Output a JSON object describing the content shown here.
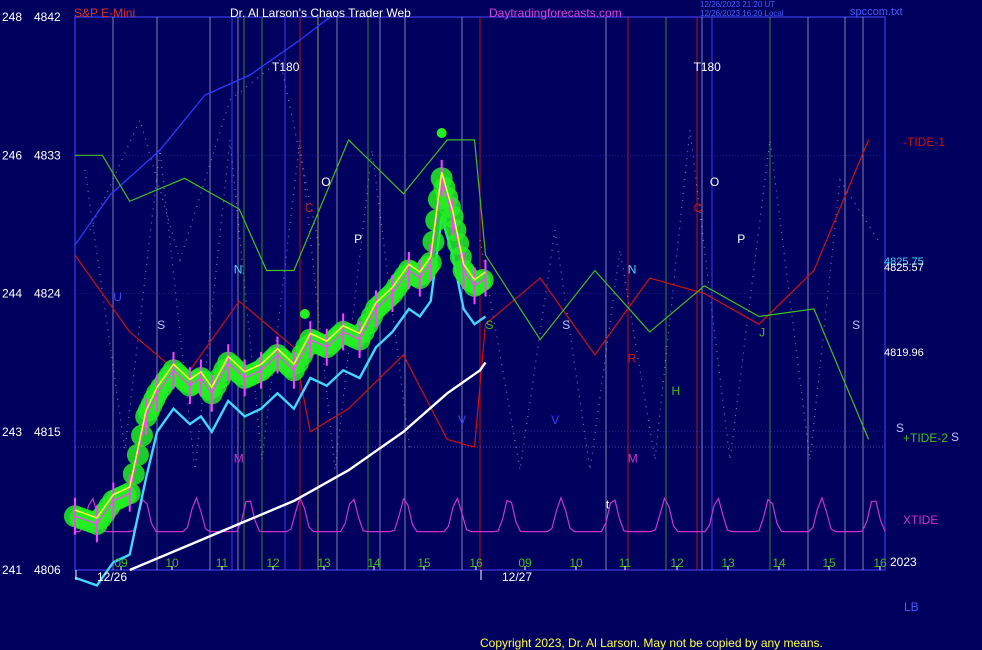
{
  "header": {
    "instrument": "S&P E-Mini",
    "site_title": "Dr. Al Larson's Chaos Trader Web",
    "site_url": "Daytradingforecasts.com",
    "timestamp_line1": "12/26/2023 21:20 UT",
    "timestamp_line2": "12/26/2023 16:20 Local",
    "file_name": "spccom.txt"
  },
  "footer": {
    "copyright": "Copyright 2023, Dr. Al Larson. May not be copied by any means."
  },
  "corner_label": "LB",
  "year_label": "2023",
  "colors": {
    "background": "#00005e",
    "frame": "#3030d0",
    "price_bars": "#ff44ff",
    "moving_average": "#ffff40",
    "glow": "#22ee22",
    "cyan_line": "#40d8ff",
    "white_line": "#ffffff",
    "blue_line": "#2a3cff",
    "tide1": "#d01010",
    "tide2": "#40c020",
    "xtide": "#cc33cc"
  },
  "chart_data": {
    "type": "line",
    "title": "S&P E-Mini",
    "x_unit": "hour of day (Dec 26 continuing into Dec 27)",
    "ylim": [
      4806,
      4842
    ],
    "y_ticks": [
      {
        "angle": "241",
        "price": "4806",
        "value": 4806
      },
      {
        "angle": "243",
        "price": "4815",
        "value": 4815
      },
      {
        "angle": "244",
        "price": "4824",
        "value": 4824
      },
      {
        "angle": "246",
        "price": "4833",
        "value": 4833
      },
      {
        "angle": "248",
        "price": "4842",
        "value": 4842
      }
    ],
    "x_ticks": [
      "09",
      "10",
      "11",
      "12",
      "13",
      "14",
      "15",
      "16",
      "09",
      "10",
      "11",
      "12",
      "13",
      "14",
      "15",
      "16"
    ],
    "date_labels": [
      "12/26",
      "12/27"
    ],
    "right_price_labels": [
      "4825.75",
      "4825.57",
      "4819.96"
    ],
    "series": [
      {
        "name": "S&P E-Mini",
        "x": [
          8.5,
          8.9,
          9.2,
          9.5,
          9.8,
          10.0,
          10.3,
          10.6,
          10.8,
          11.0,
          11.3,
          11.6,
          11.9,
          12.2,
          12.5,
          12.8,
          13.1,
          13.4,
          13.7,
          14.0,
          14.3,
          14.6,
          14.8,
          15.0,
          15.2,
          15.4,
          15.6,
          15.8,
          16.0
        ],
        "values": [
          4809.5,
          4809.0,
          4810.5,
          4811.0,
          4816.0,
          4817.5,
          4819.0,
          4818.0,
          4818.5,
          4817.5,
          4819.5,
          4818.5,
          4819.0,
          4820.0,
          4819.0,
          4821.0,
          4820.5,
          4821.5,
          4821.0,
          4823.0,
          4824.0,
          4825.5,
          4825.0,
          4826.0,
          4831.5,
          4829.0,
          4825.5,
          4824.5,
          4825.0
        ]
      },
      {
        "name": "-TIDE-1",
        "x": [
          8.5,
          9.5,
          10.5,
          11.5,
          12.5,
          12.8,
          13.5,
          14.5,
          15.3,
          15.8,
          16.0,
          17.0,
          18.0,
          19.0,
          20.0,
          21.0,
          22.0,
          23.0
        ],
        "values": [
          4826.5,
          4821.5,
          4818.5,
          4823.5,
          4820.5,
          4815.0,
          4816.5,
          4820.0,
          4814.5,
          4814.0,
          4822.0,
          4825.0,
          4820.0,
          4825.0,
          4824.0,
          4822.0,
          4825.5,
          4834.0
        ]
      },
      {
        "name": "+TIDE-2",
        "x": [
          8.5,
          9.0,
          9.5,
          10.5,
          11.5,
          12.0,
          12.5,
          13.5,
          14.5,
          15.3,
          15.8,
          16.0,
          17.0,
          18.0,
          19.0,
          20.0,
          21.0,
          22.0,
          23.0
        ],
        "values": [
          4833.0,
          4833.0,
          4830.0,
          4831.5,
          4829.5,
          4825.5,
          4825.5,
          4834.0,
          4830.5,
          4834.0,
          4834.0,
          4826.5,
          4821.0,
          4825.5,
          4821.5,
          4824.5,
          4822.5,
          4823.0,
          4814.5
        ]
      },
      {
        "name": "XTIDE",
        "x": [
          8.5,
          9.0,
          10.0,
          11.0,
          12.0,
          13.0,
          14.0,
          15.0,
          16.0,
          17.0,
          18.0,
          19.0,
          20.0,
          21.0,
          22.0,
          23.0
        ],
        "values": [
          4809.0,
          4810.0,
          4808.0,
          4808.5,
          4808.0,
          4809.0,
          4809.5,
          4810.0,
          4808.5,
          4808.0,
          4808.5,
          4809.5,
          4810.5,
          4810.0,
          4809.5,
          4809.0
        ]
      }
    ],
    "annotations": [
      {
        "text": "T180",
        "x": 12.1,
        "y": 4838.5,
        "color": "#ffffff"
      },
      {
        "text": "T180",
        "x": 19.8,
        "y": 4838.5,
        "color": "#ffffff"
      },
      {
        "text": "O",
        "x": 13.0,
        "y": 4831.0,
        "color": "#ffffff"
      },
      {
        "text": "P",
        "x": 13.6,
        "y": 4827.3,
        "color": "#ffffff"
      },
      {
        "text": "C",
        "x": 12.7,
        "y": 4829.3,
        "color": "#d01010"
      },
      {
        "text": "N",
        "x": 11.4,
        "y": 4825.3,
        "color": "#40d8ff"
      },
      {
        "text": "U",
        "x": 9.2,
        "y": 4823.5,
        "color": "#4040ff"
      },
      {
        "text": "S",
        "x": 10.0,
        "y": 4821.7,
        "color": "#c0c0ff"
      },
      {
        "text": "M",
        "x": 11.4,
        "y": 4813.0,
        "color": "#cc33cc"
      },
      {
        "text": "S",
        "x": 16.0,
        "y": 4821.7,
        "color": "#40c020"
      },
      {
        "text": "S",
        "x": 17.4,
        "y": 4821.7,
        "color": "#c0c0ff"
      },
      {
        "text": "V",
        "x": 15.5,
        "y": 4815.5,
        "color": "#4040ff"
      },
      {
        "text": "V",
        "x": 17.2,
        "y": 4815.5,
        "color": "#4040ff"
      },
      {
        "text": "N",
        "x": 18.6,
        "y": 4825.3,
        "color": "#40d8ff"
      },
      {
        "text": "O",
        "x": 20.1,
        "y": 4831.0,
        "color": "#ffffff"
      },
      {
        "text": "P",
        "x": 20.6,
        "y": 4827.3,
        "color": "#ffffff"
      },
      {
        "text": "C",
        "x": 19.8,
        "y": 4829.3,
        "color": "#d01010"
      },
      {
        "text": "R",
        "x": 18.6,
        "y": 4819.5,
        "color": "#d01010"
      },
      {
        "text": "H",
        "x": 19.4,
        "y": 4817.4,
        "color": "#40c020"
      },
      {
        "text": "M",
        "x": 18.6,
        "y": 4813.0,
        "color": "#cc33cc"
      },
      {
        "text": "J",
        "x": 21.0,
        "y": 4821.2,
        "color": "#40c020"
      },
      {
        "text": "S",
        "x": 22.7,
        "y": 4821.7,
        "color": "#c0c0ff"
      },
      {
        "text": "S",
        "x": 23.5,
        "y": 4815.0,
        "color": "#c0c0ff"
      },
      {
        "text": "t",
        "x": 18.2,
        "y": 4810.0,
        "color": "#ffffff"
      }
    ],
    "right_labels": [
      {
        "text": "-TIDE-1",
        "color": "#d01010"
      },
      {
        "text": "+TIDE-2",
        "color": "#40c020"
      },
      {
        "text": "XTIDE",
        "color": "#cc33cc"
      }
    ],
    "grid": true,
    "legend": "right side labels"
  }
}
